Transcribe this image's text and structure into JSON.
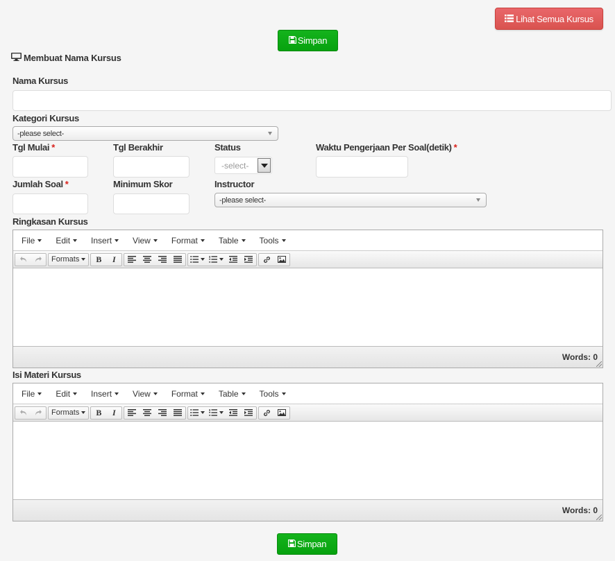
{
  "header": {
    "list_button_label": "Lihat Semua Kursus",
    "save_label_top": "Simpan",
    "section_title": "Membuat Nama Kursus"
  },
  "form": {
    "nama_kursus": {
      "label": "Nama Kursus",
      "value": ""
    },
    "kategori": {
      "label": "Kategori Kursus",
      "selected": "-please select-"
    },
    "tgl_mulai": {
      "label": "Tgl Mulai",
      "required": "*",
      "value": ""
    },
    "tgl_berakhir": {
      "label": "Tgl Berakhir",
      "value": ""
    },
    "status": {
      "label": "Status",
      "selected": "-select-"
    },
    "waktu": {
      "label": "Waktu Pengerjaan Per Soal(detik)",
      "required": "*",
      "value": ""
    },
    "jumlah_soal": {
      "label": "Jumlah Soal",
      "required": "*",
      "value": ""
    },
    "minimum_skor": {
      "label": "Minimum Skor",
      "value": ""
    },
    "instructor": {
      "label": "Instructor",
      "selected": "-please select-"
    }
  },
  "editors": [
    {
      "label": "Ringkasan Kursus",
      "word_count": "Words: 0"
    },
    {
      "label": "Isi Materi Kursus",
      "word_count": "Words: 0"
    }
  ],
  "editor_menu": [
    "File",
    "Edit",
    "Insert",
    "View",
    "Format",
    "Table",
    "Tools"
  ],
  "editor_toolbar": {
    "formats_label": "Formats",
    "bold_label": "B",
    "italic_label": "I"
  },
  "footer": {
    "save_label_bottom": "Simpan"
  },
  "colors": {
    "danger": "#d9534f",
    "success": "#07a20f",
    "required": "#d9211b",
    "background": "#f5f5f5"
  },
  "icons": {
    "list_button": "list-icon",
    "save_button": "floppy-disk-icon",
    "section_title": "desktop-icon"
  }
}
